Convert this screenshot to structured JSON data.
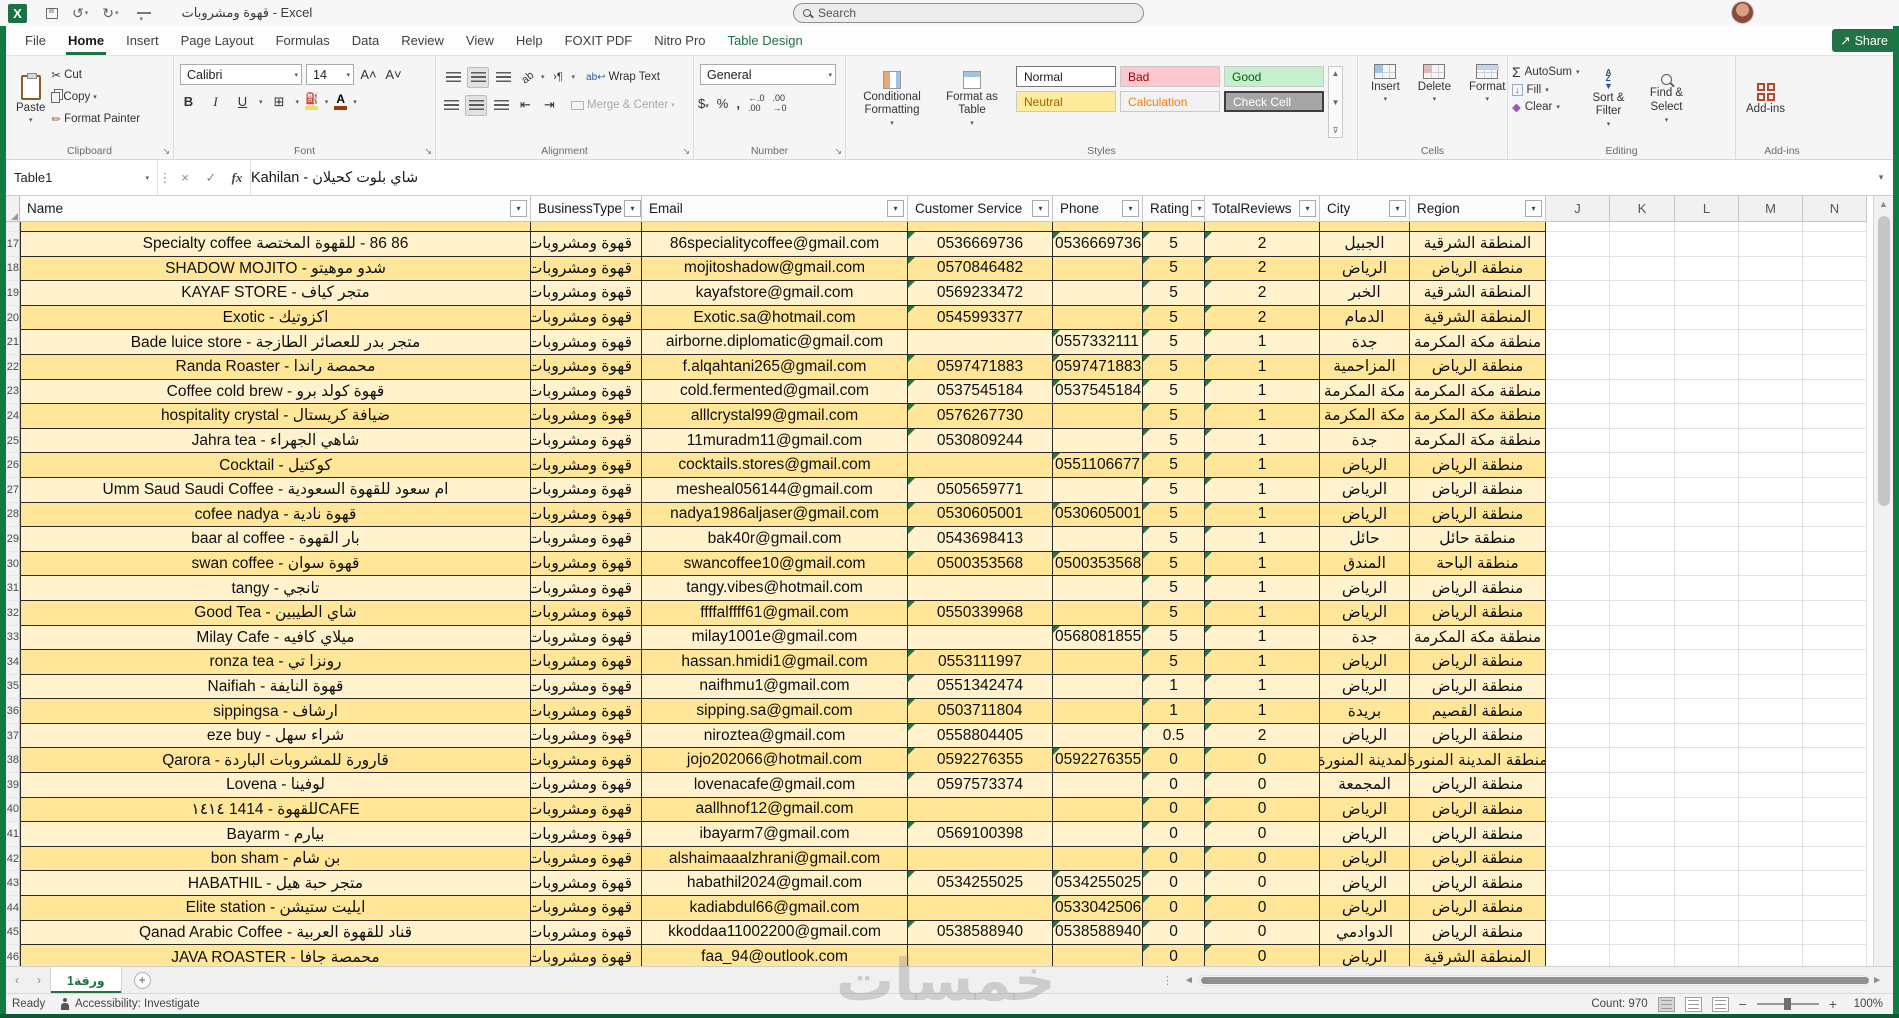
{
  "titlebar": {
    "title": "قهوة ومشروبات - Excel",
    "search_placeholder": "Search"
  },
  "tabs": [
    "File",
    "Home",
    "Insert",
    "Page Layout",
    "Formulas",
    "Data",
    "Review",
    "View",
    "Help",
    "FOXIT PDF",
    "Nitro Pro",
    "Table Design"
  ],
  "ribbon": {
    "share": "Share",
    "clipboard": {
      "label": "Clipboard",
      "paste": "Paste",
      "cut": "Cut",
      "copy": "Copy",
      "format_painter": "Format Painter"
    },
    "font": {
      "label": "Font",
      "family": "Calibri",
      "size": "14"
    },
    "alignment": {
      "label": "Alignment",
      "wrap": "Wrap Text",
      "merge": "Merge & Center"
    },
    "number": {
      "label": "Number",
      "format": "General"
    },
    "styles": {
      "label": "Styles",
      "conditional": "Conditional Formatting",
      "format_as_table": "Format as Table",
      "cells": [
        {
          "name": "Normal",
          "bg": "#FFFFFF",
          "fg": "#1a1a1a"
        },
        {
          "name": "Bad",
          "bg": "#FFC7CE",
          "fg": "#9C0006"
        },
        {
          "name": "Good",
          "bg": "#C6EFCE",
          "fg": "#006100"
        },
        {
          "name": "Neutral",
          "bg": "#FFEB9C",
          "fg": "#9C6500"
        },
        {
          "name": "Calculation",
          "bg": "#F2F2F2",
          "fg": "#FA7D00"
        },
        {
          "name": "Check Cell",
          "bg": "#A5A5A5",
          "fg": "#FFFFFF"
        }
      ]
    },
    "cells": {
      "label": "Cells",
      "insert": "Insert",
      "delete": "Delete",
      "format": "Format"
    },
    "editing": {
      "label": "Editing",
      "autosum": "AutoSum",
      "fill": "Fill",
      "clear": "Clear",
      "sort": "Sort & Filter",
      "find": "Find & Select"
    },
    "addins": {
      "label": "Add-ins",
      "button": "Add-ins"
    }
  },
  "formula_bar": {
    "name_box": "Table1",
    "value": "شاي بلوت كحيلان - Kahilan"
  },
  "grid": {
    "headers": [
      "Name",
      "BusinessType",
      "Email",
      "Customer Service",
      "Phone",
      "Rating",
      "TotalReviews",
      "City",
      "Region"
    ],
    "letters": [
      "J",
      "K",
      "L",
      "M",
      "N"
    ],
    "rows": [
      {
        "n": 17,
        "name": "Specialty coffee للقهوة المختصة‎ - 86 86",
        "type": "قهوة ومشروبات",
        "email": "86specialitycoffee@gmail.com",
        "cs": "0536669736",
        "phone": "0536669736",
        "rating": "5",
        "reviews": "2",
        "city": "الجبيل",
        "region": "المنطقة الشرقية"
      },
      {
        "n": 18,
        "name": "SHADOW MOJITO - شدو موهيتو",
        "type": "قهوة ومشروبات",
        "email": "mojitoshadow@gmail.com",
        "cs": "0570846482",
        "phone": "",
        "rating": "5",
        "reviews": "2",
        "city": "الرياض",
        "region": "منطقة الرياض"
      },
      {
        "n": 19,
        "name": "KAYAF STORE - متجر كياف",
        "type": "قهوة ومشروبات",
        "email": "kayafstore@gmail.com",
        "cs": "0569233472",
        "phone": "",
        "rating": "5",
        "reviews": "2",
        "city": "الخبر",
        "region": "المنطقة الشرقية"
      },
      {
        "n": 20,
        "name": "Exotic - اكزوتيك",
        "type": "قهوة ومشروبات",
        "email": "Exotic.sa@hotmail.com",
        "cs": "0545993377",
        "phone": "",
        "rating": "5",
        "reviews": "2",
        "city": "الدمام",
        "region": "المنطقة الشرقية"
      },
      {
        "n": 21,
        "name": "Bade luice store - متجر بدر للعصائر الطازجة",
        "type": "قهوة ومشروبات",
        "email": "airborne.diplomatic@gmail.com",
        "cs": "",
        "phone": "0557332111",
        "rating": "5",
        "reviews": "1",
        "city": "جدة",
        "region": "منطقة مكة المكرمة"
      },
      {
        "n": 22,
        "name": "Randa Roaster - محمصة راندا",
        "type": "قهوة ومشروبات",
        "email": "f.alqahtani265@gmail.com",
        "cs": "0597471883",
        "phone": "0597471883",
        "rating": "5",
        "reviews": "1",
        "city": "المزاحمية",
        "region": "منطقة الرياض"
      },
      {
        "n": 23,
        "name": "Coffee cold brew - قهوة كولد برو",
        "type": "قهوة ومشروبات",
        "email": "cold.fermented@gmail.com",
        "cs": "0537545184",
        "phone": "0537545184",
        "rating": "5",
        "reviews": "1",
        "city": "مكة المكرمة",
        "region": "منطقة مكة المكرمة"
      },
      {
        "n": 24,
        "name": "hospitality crystal - ضيافة كريستال",
        "type": "قهوة ومشروبات",
        "email": "alllcrystal99@gmail.com",
        "cs": "0576267730",
        "phone": "",
        "rating": "5",
        "reviews": "1",
        "city": "مكة المكرمة",
        "region": "منطقة مكة المكرمة"
      },
      {
        "n": 25,
        "name": "Jahra tea - شاهي الجهراء",
        "type": "قهوة ومشروبات",
        "email": "11muradm11@gmail.com",
        "cs": "0530809244",
        "phone": "",
        "rating": "5",
        "reviews": "1",
        "city": "جدة",
        "region": "منطقة مكة المكرمة"
      },
      {
        "n": 26,
        "name": "Cocktail - كوكتيل",
        "type": "قهوة ومشروبات",
        "email": "cocktails.stores@gmail.com",
        "cs": "",
        "phone": "0551106677",
        "rating": "5",
        "reviews": "1",
        "city": "الرياض",
        "region": "منطقة الرياض"
      },
      {
        "n": 27,
        "name": "Umm Saud Saudi Coffee - ام سعود للقهوة السعودية",
        "type": "قهوة ومشروبات",
        "email": "mesheal056144@gmail.com",
        "cs": "0505659771",
        "phone": "",
        "rating": "5",
        "reviews": "1",
        "city": "الرياض",
        "region": "منطقة الرياض"
      },
      {
        "n": 28,
        "name": "cofee nadya - قهوة نادية",
        "type": "قهوة ومشروبات",
        "email": "nadya1986aljaser@gmail.com",
        "cs": "0530605001",
        "phone": "0530605001",
        "rating": "5",
        "reviews": "1",
        "city": "الرياض",
        "region": "منطقة الرياض"
      },
      {
        "n": 29,
        "name": "baar al coffee - بار القهوة",
        "type": "قهوة ومشروبات",
        "email": "bak40r@gmail.com",
        "cs": "0543698413",
        "phone": "",
        "rating": "5",
        "reviews": "1",
        "city": "حائل",
        "region": "منطقة حائل"
      },
      {
        "n": 30,
        "name": "swan coffee - قهوة سوان",
        "type": "قهوة ومشروبات",
        "email": "swancoffee10@gmail.com",
        "cs": "0500353568",
        "phone": "0500353568",
        "rating": "5",
        "reviews": "1",
        "city": "المندق",
        "region": "منطقة الباحة"
      },
      {
        "n": 31,
        "name": "tangy - تانجي",
        "type": "قهوة ومشروبات",
        "email": "tangy.vibes@hotmail.com",
        "cs": "",
        "phone": "",
        "rating": "5",
        "reviews": "1",
        "city": "الرياض",
        "region": "منطقة الرياض"
      },
      {
        "n": 32,
        "name": "Good Tea - شاي الطيبين",
        "type": "قهوة ومشروبات",
        "email": "ffffalffff61@gmail.com",
        "cs": "0550339968",
        "phone": "",
        "rating": "5",
        "reviews": "1",
        "city": "الرياض",
        "region": "منطقة الرياض"
      },
      {
        "n": 33,
        "name": "Milay Cafe - ميلاي كافيه",
        "type": "قهوة ومشروبات",
        "email": "milay1001e@gmail.com",
        "cs": "",
        "phone": "0568081855",
        "rating": "5",
        "reviews": "1",
        "city": "جدة",
        "region": "منطقة مكة المكرمة"
      },
      {
        "n": 34,
        "name": "ronza tea - رونزا تي",
        "type": "قهوة ومشروبات",
        "email": "hassan.hmidi1@gmail.com",
        "cs": "0553111997",
        "phone": "",
        "rating": "5",
        "reviews": "1",
        "city": "الرياض",
        "region": "منطقة الرياض"
      },
      {
        "n": 35,
        "name": "Naifiah - قهوة النايفة",
        "type": "قهوة ومشروبات",
        "email": "naifhmu1@gmail.com",
        "cs": "0551342474",
        "phone": "",
        "rating": "1",
        "reviews": "1",
        "city": "الرياض",
        "region": "منطقة الرياض"
      },
      {
        "n": 36,
        "name": "sippingsa - ارشاف",
        "type": "قهوة ومشروبات",
        "email": "sipping.sa@gmail.com",
        "cs": "0503711804",
        "phone": "",
        "rating": "1",
        "reviews": "1",
        "city": "بريدة",
        "region": "منطقة القصيم"
      },
      {
        "n": 37,
        "name": "eze buy - شراء سهل",
        "type": "قهوة ومشروبات",
        "email": "niroztea@gmail.com",
        "cs": "0558804405",
        "phone": "",
        "rating": "0.5",
        "reviews": "2",
        "city": "الرياض",
        "region": "منطقة الرياض"
      },
      {
        "n": 38,
        "name": "Qarora - قارورة للمشروبات الباردة",
        "type": "قهوة ومشروبات",
        "email": "jojo202066@hotmail.com",
        "cs": "0592276355",
        "phone": "0592276355",
        "rating": "0",
        "reviews": "0",
        "city": "المدينة المنورة",
        "region": "منطقة المدينة المنورة"
      },
      {
        "n": 39,
        "name": "Lovena - لوفينا",
        "type": "قهوة ومشروبات",
        "email": "lovenacafe@gmail.com",
        "cs": "0597573374",
        "phone": "",
        "rating": "0",
        "reviews": "0",
        "city": "المجمعة",
        "region": "منطقة الرياض"
      },
      {
        "n": 40,
        "name": "١٤١٤ 1414 - للقهوةCAFE",
        "type": "قهوة ومشروبات",
        "email": "aallhnof12@gmail.com",
        "cs": "",
        "phone": "",
        "rating": "0",
        "reviews": "0",
        "city": "الرياض",
        "region": "منطقة الرياض"
      },
      {
        "n": 41,
        "name": "Bayarm - بيارم",
        "type": "قهوة ومشروبات",
        "email": "ibayarm7@gmail.com",
        "cs": "0569100398",
        "phone": "",
        "rating": "0",
        "reviews": "0",
        "city": "الرياض",
        "region": "منطقة الرياض"
      },
      {
        "n": 42,
        "name": "bon sham - بن شام",
        "type": "قهوة ومشروبات",
        "email": "alshaimaaalzhrani@gmail.com",
        "cs": "",
        "phone": "",
        "rating": "0",
        "reviews": "0",
        "city": "الرياض",
        "region": "منطقة الرياض"
      },
      {
        "n": 43,
        "name": "HABATHIL - متجر حبة هيل",
        "type": "قهوة ومشروبات",
        "email": "habathil2024@gmail.com",
        "cs": "0534255025",
        "phone": "0534255025",
        "rating": "0",
        "reviews": "0",
        "city": "الرياض",
        "region": "منطقة الرياض"
      },
      {
        "n": 44,
        "name": "Elite station - ايليت ستيشن",
        "type": "قهوة ومشروبات",
        "email": "kadiabdul66@gmail.com",
        "cs": "",
        "phone": "0533042506",
        "rating": "0",
        "reviews": "0",
        "city": "الرياض",
        "region": "منطقة الرياض"
      },
      {
        "n": 45,
        "name": "Qanad Arabic Coffee - قناد للقهوة العربية",
        "type": "قهوة ومشروبات",
        "email": "kkoddaa11002200@gmail.com",
        "cs": "0538588940",
        "phone": "0538588940",
        "rating": "0",
        "reviews": "0",
        "city": "الدوادمي",
        "region": "منطقة الرياض"
      },
      {
        "n": 46,
        "name": "JAVA ROASTER - محمصة جافا",
        "type": "قهوة ومشروبات",
        "email": "faa_94@outlook.com",
        "cs": "",
        "phone": "",
        "rating": "0",
        "reviews": "0",
        "city": "الرياض",
        "region": "المنطقة الشرقية"
      }
    ]
  },
  "sheetbar": {
    "tab": "ورقة1",
    "watermark": "خمسات"
  },
  "statusbar": {
    "ready": "Ready",
    "accessibility": "Accessibility: Investigate",
    "count": "Count: 970",
    "zoom": "100%"
  }
}
